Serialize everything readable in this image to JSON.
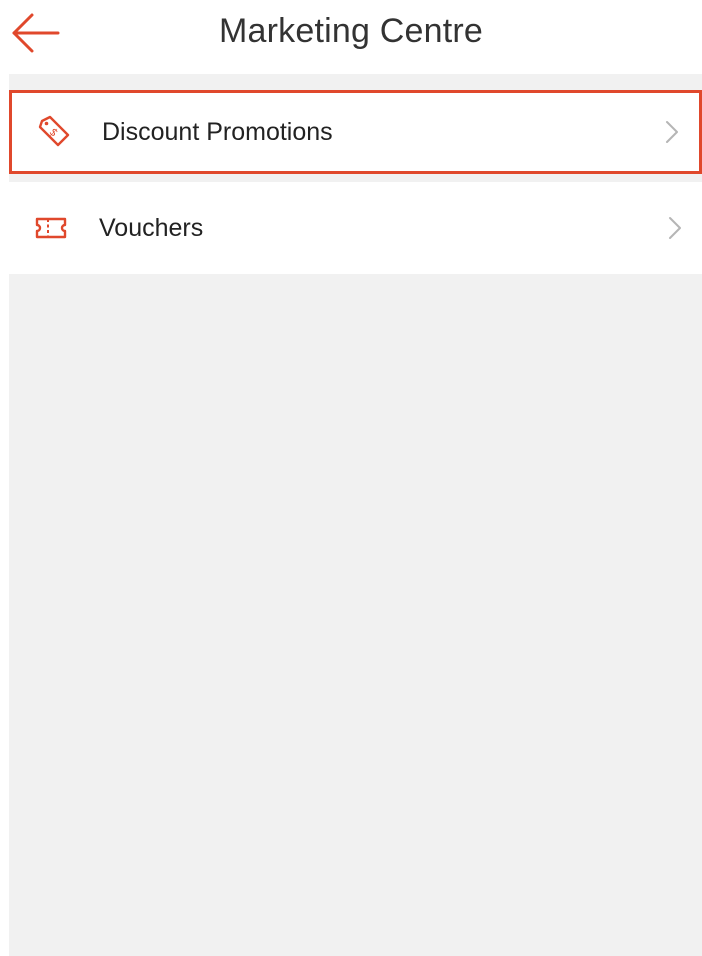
{
  "header": {
    "title": "Marketing Centre",
    "back_icon": "arrow-left-icon"
  },
  "menu": {
    "items": [
      {
        "label": "Discount Promotions",
        "icon": "price-tag-icon",
        "highlighted": true
      },
      {
        "label": "Vouchers",
        "icon": "voucher-ticket-icon",
        "highlighted": false
      }
    ]
  },
  "colors": {
    "accent": "#e0482c",
    "background": "#f1f1f1",
    "text": "#222222",
    "chevron": "#b5b5b5"
  }
}
